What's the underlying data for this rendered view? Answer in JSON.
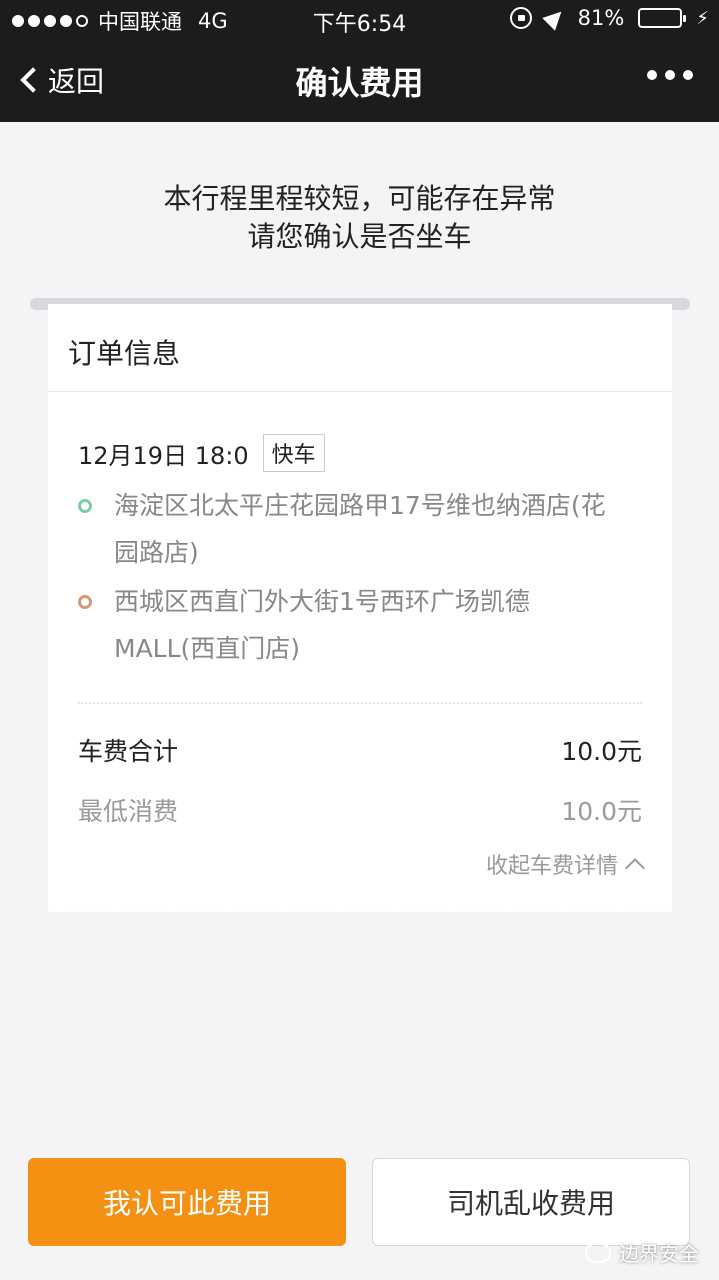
{
  "status_bar": {
    "carrier": "中国联通",
    "network": "4G",
    "time": "下午6:54",
    "battery": "81%",
    "battery_level": 0.81
  },
  "nav": {
    "back_label": "返回",
    "title": "确认费用"
  },
  "warning": {
    "line1": "本行程里程较短，可能存在异常",
    "line2": "请您确认是否坐车"
  },
  "order": {
    "header": "订单信息",
    "datetime": "12月19日 18:0",
    "ride_type": "快车",
    "pickup_line1": "海淀区北太平庄花园路甲17号维也纳酒店(花",
    "pickup_line2": "园路店)",
    "dropoff_line1": "西城区西直门外大街1号西环广场凯德",
    "dropoff_line2": "MALL(西直门店)",
    "fare_total_label": "车费合计",
    "fare_total_value": "10.0元",
    "fare_min_label": "最低消费",
    "fare_min_value": "10.0元",
    "collapse_label": "收起车费详情"
  },
  "buttons": {
    "confirm": "我认可此费用",
    "dispute": "司机乱收费用"
  },
  "watermark": "边界安全"
}
